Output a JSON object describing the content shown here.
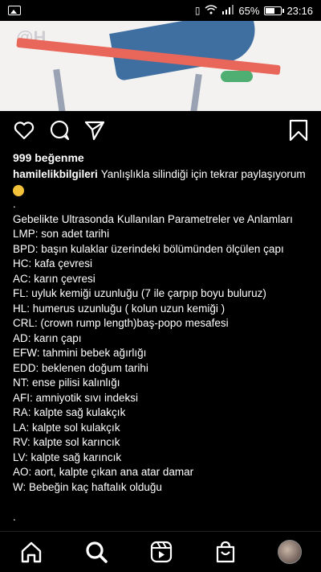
{
  "status_bar": {
    "battery_percent": "65%",
    "time": "23:16",
    "battery_level": 0.65
  },
  "post": {
    "image_watermark": "@H",
    "likes": "999 beğenme",
    "username": "hamilelikbilgileri",
    "caption_intro": "Yanlışlıkla silindiği için tekrar paylaşıyorum",
    "caption_lines": [
      ".",
      "Gebelikte Ultrasonda Kullanılan Parametreler ve Anlamları",
      "LMP: son adet tarihi",
      "BPD: başın kulaklar üzerindeki bölümünden ölçülen çapı",
      "HC: kafa çevresi",
      "AC: karın çevresi",
      "FL: uyluk kemiği uzunluğu (7 ile çarpıp boyu buluruz)",
      "HL: humerus uzunluğu ( kolun uzun kemiği )",
      "CRL: (crown rump length)baş-popo mesafesi",
      "AD: karın çapı",
      "EFW: tahmini bebek ağırlığı",
      "EDD: beklenen doğum tarihi",
      "NT: ense pilisi kalınlığı",
      "AFI: amniyotik sıvı indeksi",
      "RA: kalpte sağ kulakçık",
      "LA: kalpte sol kulakçık",
      "RV: kalpte sol karıncık",
      "LV: kalpte sağ karıncık",
      "AO: aort, kalpte çıkan ana atar damar",
      "W: Bebeğin kaç haftalık olduğu",
      "",
      "."
    ]
  },
  "icons": {
    "like": "heart-icon",
    "comment": "comment-icon",
    "share": "send-icon",
    "save": "bookmark-icon"
  },
  "bottom_nav": [
    "home-icon",
    "search-icon",
    "reels-icon",
    "shop-icon",
    "profile-avatar"
  ]
}
